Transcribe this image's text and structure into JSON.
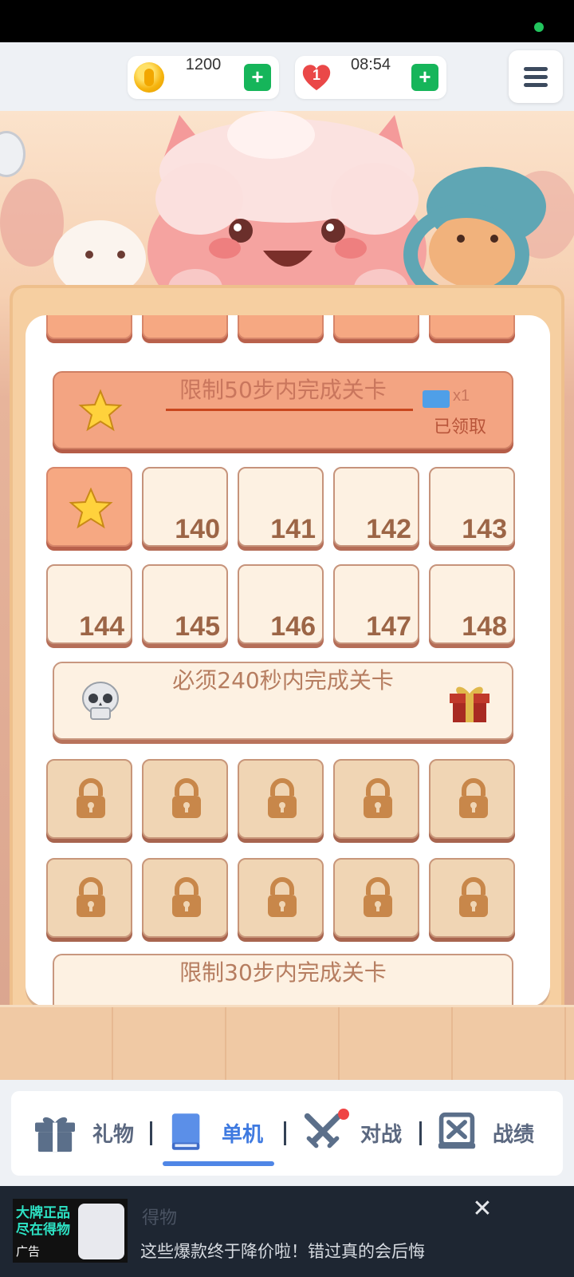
{
  "status": {
    "indicator_color": "#22c55e"
  },
  "header": {
    "coins": {
      "value": "1200",
      "add_label": "+"
    },
    "lives": {
      "count": "1",
      "timer": "08:54",
      "add_label": "+"
    },
    "menu_icon": "hamburger-icon"
  },
  "board": {
    "top_partial_row": [
      "star",
      "star",
      "star",
      "star",
      "star"
    ],
    "challenge_completed": {
      "text": "限制50步内完成关卡",
      "reward_icon": "ticket-icon",
      "reward_qty": "x1",
      "status": "已领取"
    },
    "row_1": [
      {
        "type": "star"
      },
      {
        "type": "open",
        "label": "140"
      },
      {
        "type": "open",
        "label": "141"
      },
      {
        "type": "open",
        "label": "142"
      },
      {
        "type": "open",
        "label": "143"
      }
    ],
    "row_2": [
      {
        "type": "open",
        "label": "144"
      },
      {
        "type": "open",
        "label": "145"
      },
      {
        "type": "open",
        "label": "146"
      },
      {
        "type": "open",
        "label": "147"
      },
      {
        "type": "open",
        "label": "148"
      }
    ],
    "challenge_next": {
      "text": "必须240秒内完成关卡",
      "icon": "skull-icon",
      "reward_icon": "gift-icon"
    },
    "locked_rows": 2,
    "locked_per_row": 5,
    "partial_bottom_banner": {
      "text": "限制30步内完成关卡"
    }
  },
  "nav": {
    "items": [
      {
        "label": "礼物",
        "icon": "gift-icon"
      },
      {
        "label": "单机",
        "icon": "book-icon",
        "active": true
      },
      {
        "label": "对战",
        "icon": "crossed-swords-icon",
        "notification": true
      },
      {
        "label": "战绩",
        "icon": "scroll-x-icon"
      }
    ]
  },
  "ad": {
    "thumb_text": "大牌正品 尽在得物",
    "badge": "广告",
    "title": "得物",
    "description": "这些爆款终于降价啦！错过真的会后悔",
    "close_icon": "close-icon"
  },
  "colors": {
    "accent_green": "#16b55a",
    "nav_active": "#3f7ae0",
    "tile_text": "#9c6546"
  }
}
